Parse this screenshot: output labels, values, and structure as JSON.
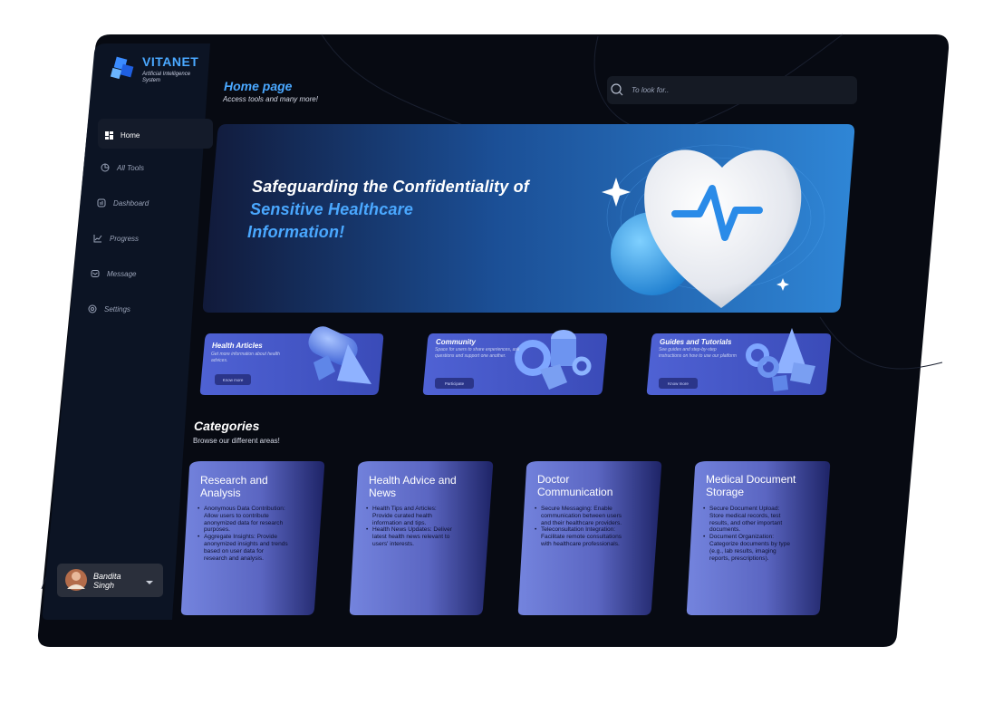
{
  "brand": {
    "name": "VITANET",
    "tagline": "Artificial Intelligence System"
  },
  "header": {
    "title": "Home page",
    "subtitle": "Access tools and many more!"
  },
  "search": {
    "placeholder": "To look for.."
  },
  "sidebar": {
    "items": [
      {
        "label": "Home",
        "icon": "grid-icon",
        "active": true
      },
      {
        "label": "All Tools",
        "icon": "pie-chart-icon"
      },
      {
        "label": "Dashboard",
        "icon": "dashboard-icon"
      },
      {
        "label": "Progress",
        "icon": "line-chart-icon"
      },
      {
        "label": "Message",
        "icon": "message-icon"
      },
      {
        "label": "Settings",
        "icon": "gear-icon"
      }
    ],
    "user": {
      "first": "Bandita",
      "last": "Singh"
    }
  },
  "hero": {
    "line1": "Safeguarding the Confidentiality of",
    "line2": "Sensitive Healthcare",
    "line3": "Information!"
  },
  "features": [
    {
      "title": "Health Articles",
      "desc": "Get more information about health advices.",
      "button": "Know more"
    },
    {
      "title": "Community",
      "desc": "Space for users to share experiences, ask questions and support one another.",
      "button": "Participate"
    },
    {
      "title": "Guides and Tutorials",
      "desc": "See guides and step-by-step instructions on how to use our platform",
      "button": "Know more"
    }
  ],
  "categories": {
    "title": "Categories",
    "subtitle": "Browse our different areas!",
    "items": [
      {
        "title": "Research and Analysis",
        "bullets": [
          "Anonymous Data Contribution: Allow users to contribute anonymized data for research purposes.",
          "Aggregate Insights: Provide anonymized insights and trends based on user data for research and analysis."
        ]
      },
      {
        "title": "Health Advice and News",
        "bullets": [
          "Health Tips and Articles: Provide curated health information and tips.",
          "Health News Updates: Deliver latest health news relevant to users' interests."
        ]
      },
      {
        "title": "Doctor Communication",
        "bullets": [
          "Secure Messaging: Enable communication between users and their healthcare providers.",
          "Teleconsultation Integration: Facilitate remote consultations with healthcare professionals."
        ]
      },
      {
        "title": "Medical Document Storage",
        "bullets": [
          "Secure Document Upload: Store medical records, test results, and other important documents.",
          "Document Organization: Categorize documents by type (e.g., lab results, imaging reports, prescriptions)."
        ]
      }
    ]
  },
  "colors": {
    "accent": "#4aa8ff",
    "background": "#070a12",
    "sidebar": "#0c1424",
    "card": "#6f7fd6"
  }
}
